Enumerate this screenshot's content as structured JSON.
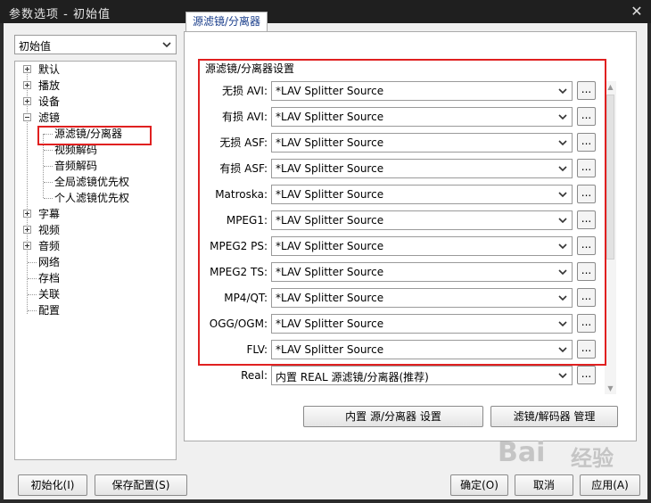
{
  "window": {
    "title": "参数选项 - 初始值",
    "close_icon": "close-icon"
  },
  "profile": {
    "selected": "初始值"
  },
  "tree": {
    "items": [
      {
        "label": "默认"
      },
      {
        "label": "播放"
      },
      {
        "label": "设备"
      },
      {
        "label": "滤镜"
      },
      {
        "label": "源滤镜/分离器"
      },
      {
        "label": "视频解码"
      },
      {
        "label": "音频解码"
      },
      {
        "label": "全局滤镜优先权"
      },
      {
        "label": "个人滤镜优先权"
      },
      {
        "label": "字幕"
      },
      {
        "label": "视频"
      },
      {
        "label": "音频"
      },
      {
        "label": "网络"
      },
      {
        "label": "存档"
      },
      {
        "label": "关联"
      },
      {
        "label": "配置"
      }
    ]
  },
  "tab": {
    "label": "源滤镜/分离器"
  },
  "group": {
    "label": "源滤镜/分离器设置"
  },
  "rows": [
    {
      "label": "无损 AVI:",
      "value": "*LAV Splitter Source"
    },
    {
      "label": "有损 AVI:",
      "value": "*LAV Splitter Source"
    },
    {
      "label": "无损 ASF:",
      "value": "*LAV Splitter Source"
    },
    {
      "label": "有损 ASF:",
      "value": "*LAV Splitter Source"
    },
    {
      "label": "Matroska:",
      "value": "*LAV Splitter Source"
    },
    {
      "label": "MPEG1:",
      "value": "*LAV Splitter Source"
    },
    {
      "label": "MPEG2 PS:",
      "value": "*LAV Splitter Source"
    },
    {
      "label": "MPEG2 TS:",
      "value": "*LAV Splitter Source"
    },
    {
      "label": "MP4/QT:",
      "value": "*LAV Splitter Source"
    },
    {
      "label": "OGG/OGM:",
      "value": "*LAV Splitter Source"
    },
    {
      "label": "FLV:",
      "value": "*LAV Splitter Source"
    },
    {
      "label": "Real:",
      "value": "内置 REAL 源滤镜/分离器(推荐)"
    }
  ],
  "browse_label": "...",
  "actions": {
    "builtin_settings": "内置 源/分离器 设置",
    "filter_manager": "滤镜/解码器 管理"
  },
  "footer": {
    "reset": "初始化(I)",
    "save_config": "保存配置(S)",
    "ok": "确定(O)",
    "cancel": "取消",
    "apply": "应用(A)"
  },
  "watermark": {
    "text": "Bai",
    "text2": "经验"
  },
  "colors": {
    "highlight": "#e02020",
    "title_bg": "#1f1f1f",
    "tab_text": "#1b3f8c"
  }
}
